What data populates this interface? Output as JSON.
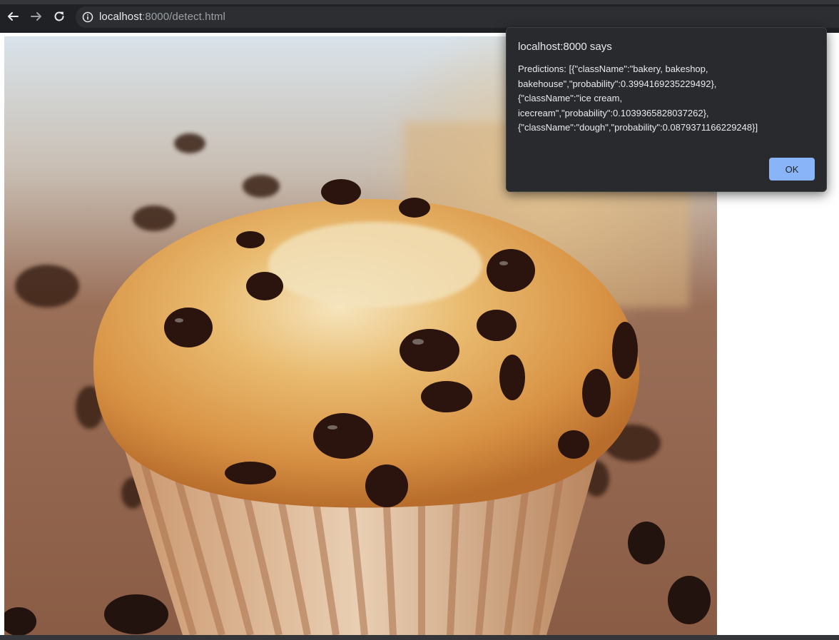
{
  "browser": {
    "url_host": "localhost",
    "url_rest": ":8000/detect.html",
    "icons": {
      "back": "back-arrow-icon",
      "forward": "forward-arrow-icon",
      "reload": "reload-icon",
      "site_info": "info-icon"
    }
  },
  "page": {
    "image_subject": "chocolate chip muffin"
  },
  "dialog": {
    "title": "localhost:8000 says",
    "message": "Predictions: [{\"className\":\"bakery, bakeshop,\nbakehouse\",\"probability\":0.3994169235229492},\n{\"className\":\"ice cream,\nicecream\",\"probability\":0.1039365828037262},\n{\"className\":\"dough\",\"probability\":0.0879371166229248}]",
    "ok_label": "OK"
  },
  "colors": {
    "toolbar_bg": "#202124",
    "omnibox_bg": "#2d2e31",
    "dialog_bg": "#292a2d",
    "ok_button": "#8ab4f8"
  }
}
